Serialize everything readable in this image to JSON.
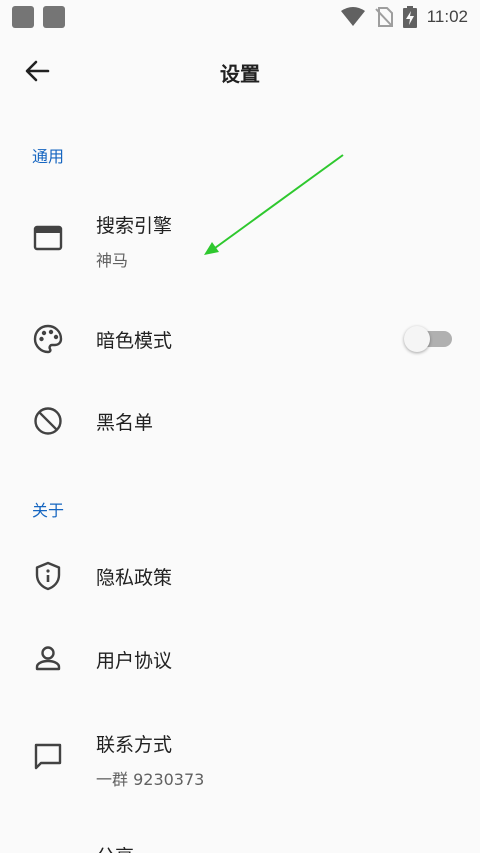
{
  "status_bar": {
    "time": "11:02"
  },
  "toolbar": {
    "title": "设置"
  },
  "sections": {
    "general": "通用",
    "about": "关于"
  },
  "items": {
    "search_engine": {
      "title": "搜索引擎",
      "summary": "神马"
    },
    "dark_mode": {
      "title": "暗色模式",
      "enabled": false
    },
    "blacklist": {
      "title": "黑名单"
    },
    "privacy": {
      "title": "隐私政策"
    },
    "agreement": {
      "title": "用户协议"
    },
    "contact": {
      "title": "联系方式",
      "summary": "一群 9230373"
    },
    "share": {
      "title": "分享"
    }
  },
  "colors": {
    "accent": "#1565c0",
    "annotation_arrow": "#2ec82e"
  }
}
